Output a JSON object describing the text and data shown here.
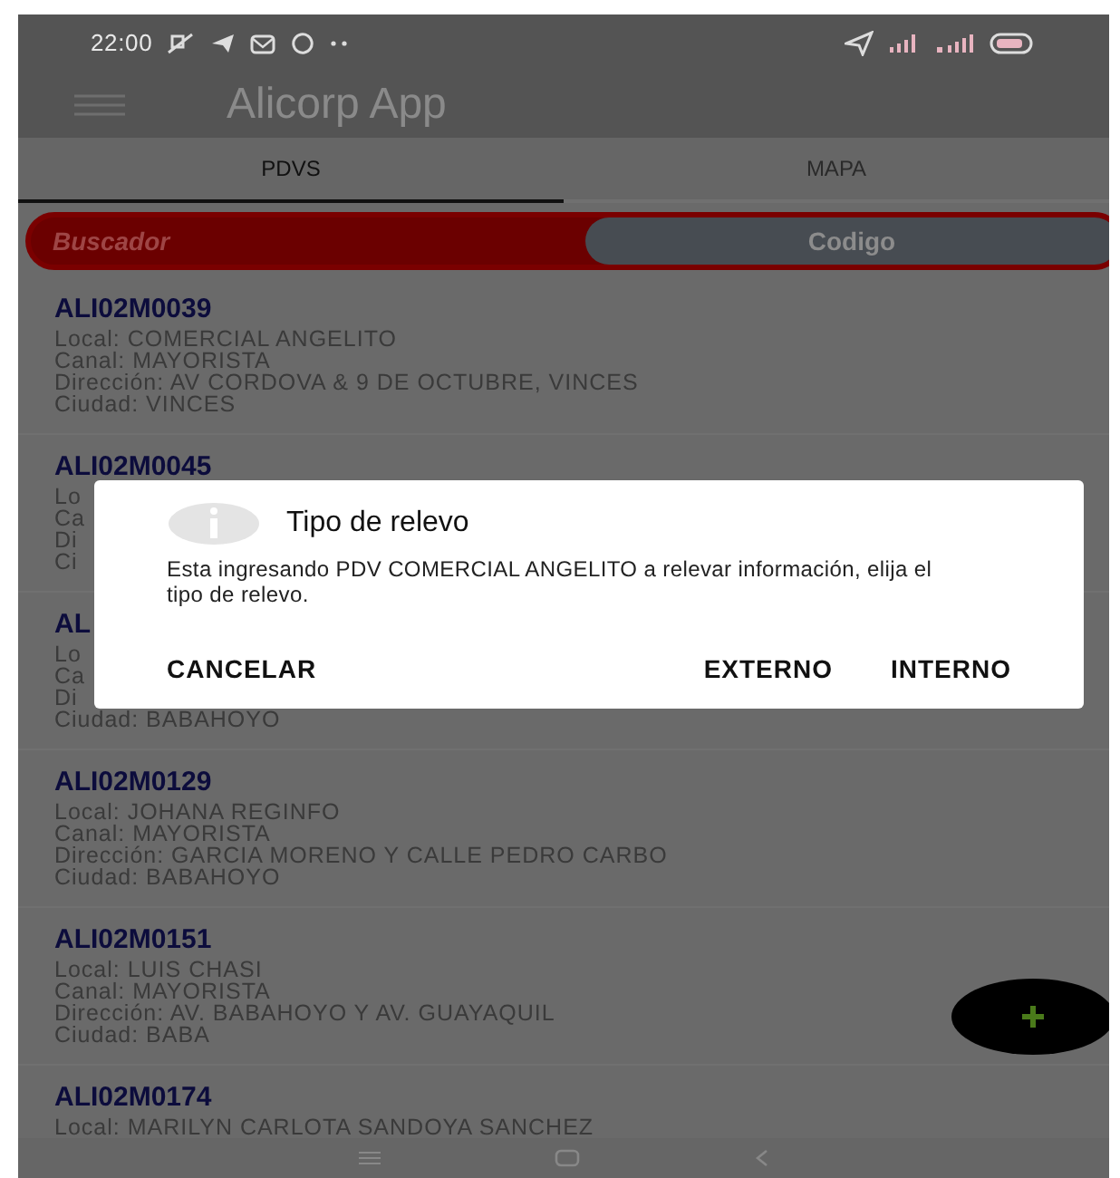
{
  "status_bar": {
    "time": "22:00"
  },
  "app_bar": {
    "title": "Alicorp App"
  },
  "tabs": [
    {
      "label": "PDVS",
      "selected": true
    },
    {
      "label": "MAPA",
      "selected": false
    }
  ],
  "search_toggle": [
    {
      "label": "Buscador",
      "selected": true
    },
    {
      "label": "Codigo",
      "selected": false
    }
  ],
  "pdvs": [
    {
      "code": "ALI02M0039",
      "lines": [
        "Local: COMERCIAL ANGELITO",
        "Canal: MAYORISTA",
        "Dirección: AV CORDOVA & 9 DE OCTUBRE, VINCES",
        "Ciudad: VINCES"
      ]
    },
    {
      "code": "ALI02M0045",
      "lines": [
        "Lo",
        "Ca",
        "Di",
        "Ci"
      ]
    },
    {
      "code": "AL",
      "lines": [
        "Lo",
        "Ca",
        "Di",
        "Ciudad: BABAHOYO"
      ]
    },
    {
      "code": "ALI02M0129",
      "lines": [
        "Local: JOHANA REGINFO",
        "Canal: MAYORISTA",
        "Dirección: GARCIA MORENO Y CALLE PEDRO CARBO",
        "Ciudad: BABAHOYO"
      ]
    },
    {
      "code": "ALI02M0151",
      "lines": [
        "Local: LUIS CHASI",
        "Canal: MAYORISTA",
        "Dirección: AV. BABAHOYO Y AV. GUAYAQUIL",
        "Ciudad: BABA"
      ]
    },
    {
      "code": "ALI02M0174",
      "lines": [
        "Local: MARILYN CARLOTA SANDOYA SANCHEZ"
      ]
    }
  ],
  "dialog": {
    "title": "Tipo de relevo",
    "message": "Esta ingresando PDV COMERCIAL ANGELITO a relevar información, elija el tipo de relevo.",
    "buttons": [
      {
        "label": "CANCELAR",
        "kind": "left"
      },
      {
        "label": "EXTERNO",
        "kind": "right"
      },
      {
        "label": "INTERNO",
        "kind": "right"
      }
    ]
  }
}
